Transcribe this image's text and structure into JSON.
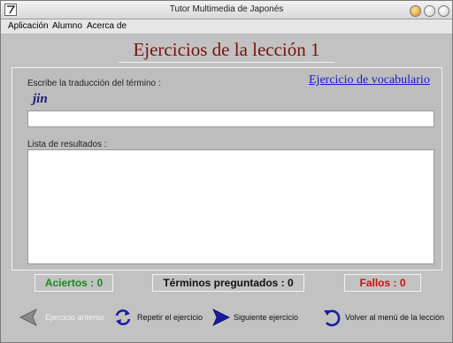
{
  "window": {
    "title": "Tutor Multimedia de Japonés"
  },
  "menu": {
    "items": [
      "Aplicación",
      "Alumno",
      "Acerca de"
    ]
  },
  "header": {
    "lesson_title": "Ejercicios de la lección 1"
  },
  "exercise": {
    "prompt_label": "Escribe la traducción del término :",
    "vocab_link": "Ejercicio de vocabulario",
    "term": "jin",
    "answer_value": "",
    "results_label": "Lista de resultados :",
    "results": []
  },
  "stats": {
    "correct": "Aciertos : 0",
    "asked": "Términos preguntados : 0",
    "wrong": "Fallos : 0"
  },
  "nav": {
    "prev": "Ejercicio anterior",
    "repeat": "Repetir el ejercicio",
    "next": "Siguiente ejercicio",
    "back": "Volver al menú de la lección"
  },
  "colors": {
    "title": "#7a1010",
    "link": "#1a1acc",
    "correct": "#1a8a1a",
    "wrong": "#d01010",
    "nav_icon": "#1a1aa0"
  },
  "icons": {
    "app": "pen-icon",
    "prev": "arrow-left-icon",
    "repeat": "repeat-icon",
    "next": "arrow-right-icon",
    "back": "return-icon"
  }
}
